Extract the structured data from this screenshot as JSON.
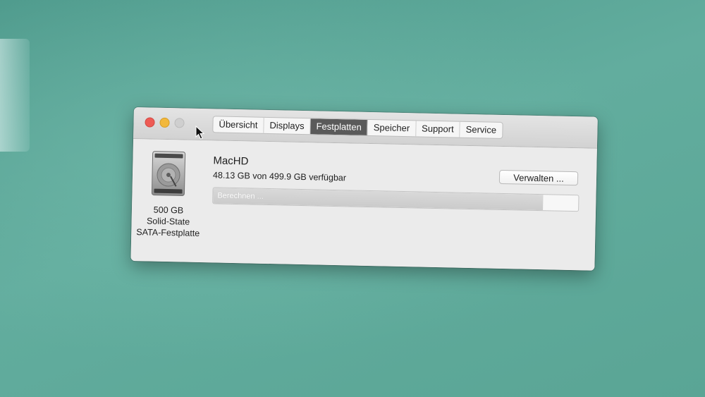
{
  "window": {
    "tabs": [
      {
        "label": "Übersicht",
        "active": false
      },
      {
        "label": "Displays",
        "active": false
      },
      {
        "label": "Festplatten",
        "active": true
      },
      {
        "label": "Speicher",
        "active": false
      },
      {
        "label": "Support",
        "active": false
      },
      {
        "label": "Service",
        "active": false
      }
    ]
  },
  "disk": {
    "icon": "hard-drive-icon",
    "caption_line1": "500 GB",
    "caption_line2": "Solid-State",
    "caption_line3": "SATA-Festplatte",
    "name": "MacHD",
    "free_text": "48.13 GB von 499.9 GB verfügbar",
    "manage_label": "Verwalten ...",
    "storage_bar_label": "Berechnen ...",
    "used_fraction": 0.904
  },
  "colors": {
    "close": "#ee5b55",
    "minimize": "#f2b83c",
    "zoom_inactive": "#cfcfcf",
    "active_tab": "#5a5a5a",
    "desktop": "#5fa799"
  }
}
